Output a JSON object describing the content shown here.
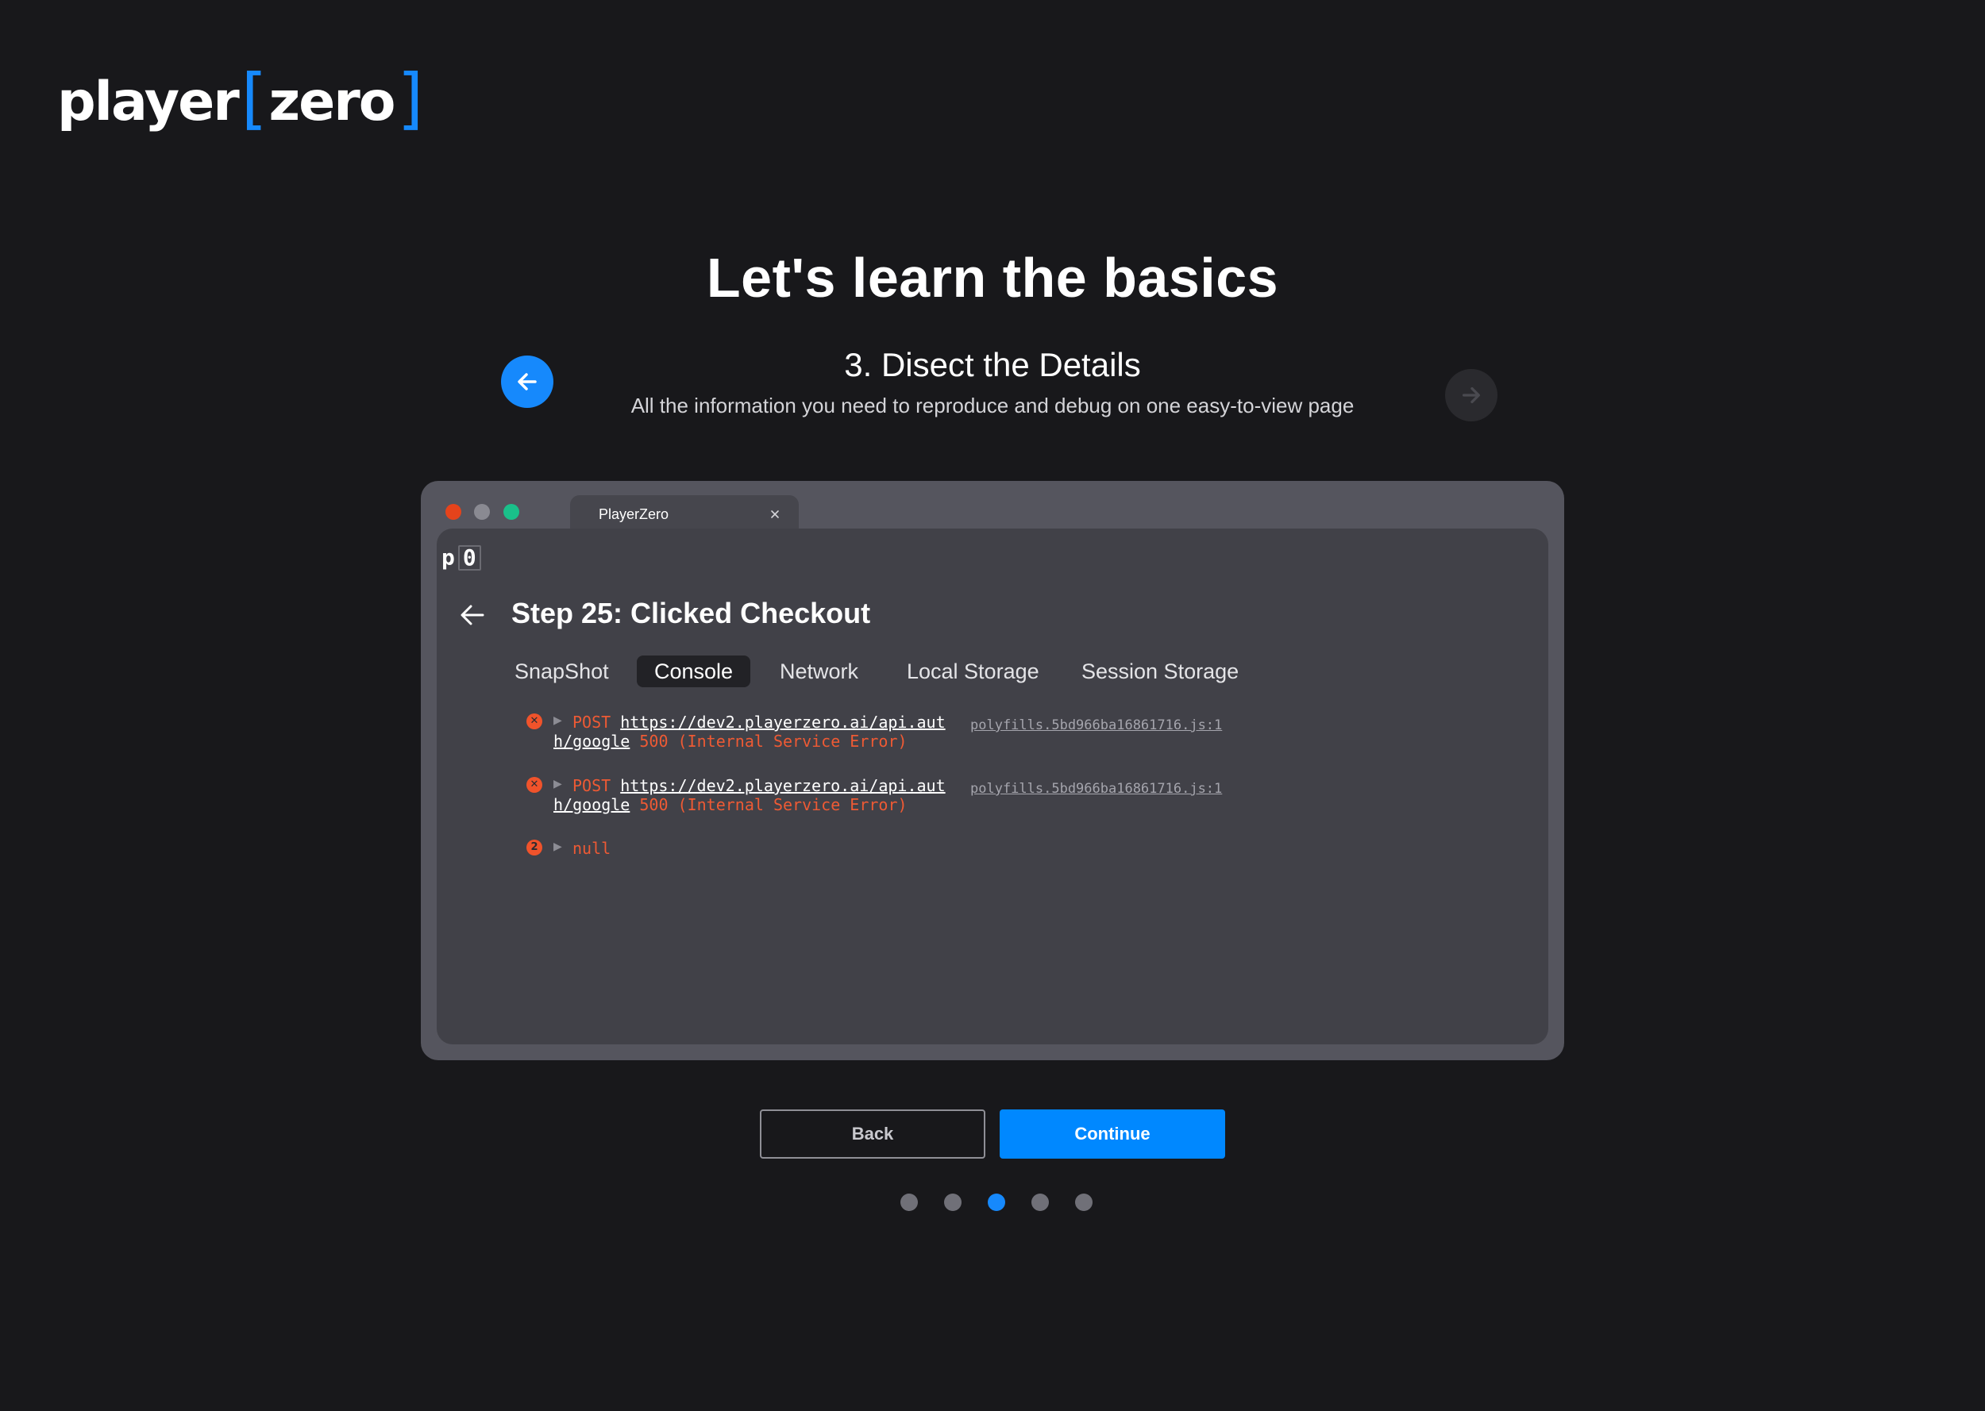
{
  "brand": {
    "logo_left": "player",
    "logo_right": "zero",
    "accent_color": "#1689fc"
  },
  "onboarding": {
    "title": "Let's learn the basics",
    "step_title": "3. Disect the Details",
    "step_subtitle": "All the information you need to reproduce and debug on one easy-to-view page",
    "prev_icon": "arrow-left-icon",
    "next_icon": "arrow-right-icon"
  },
  "browser": {
    "tab_label": "PlayerZero",
    "mini_logo_left": "p",
    "mini_logo_right": "0",
    "detail_title": "Step 25: Clicked Checkout",
    "tabs": [
      {
        "label": "SnapShot",
        "active": false
      },
      {
        "label": "Console",
        "active": true
      },
      {
        "label": "Network",
        "active": false
      },
      {
        "label": "Local Storage",
        "active": false
      },
      {
        "label": "Session Storage",
        "active": false
      }
    ],
    "console": [
      {
        "method": "POST",
        "url_part1": "https://dev2.playerzero.ai/api.aut",
        "url_part2": "h/google",
        "status": "500 (Internal Service Error)",
        "source": "polyfills.5bd966ba16861716.js:1"
      },
      {
        "method": "POST",
        "url_part1": "https://dev2.playerzero.ai/api.aut",
        "url_part2": "h/google",
        "status": "500 (Internal Service Error)",
        "source": "polyfills.5bd966ba16861716.js:1"
      },
      {
        "count": "2",
        "value": "null"
      }
    ]
  },
  "actions": {
    "back_label": "Back",
    "continue_label": "Continue"
  },
  "pagination": {
    "total": 5,
    "current": 3
  }
}
